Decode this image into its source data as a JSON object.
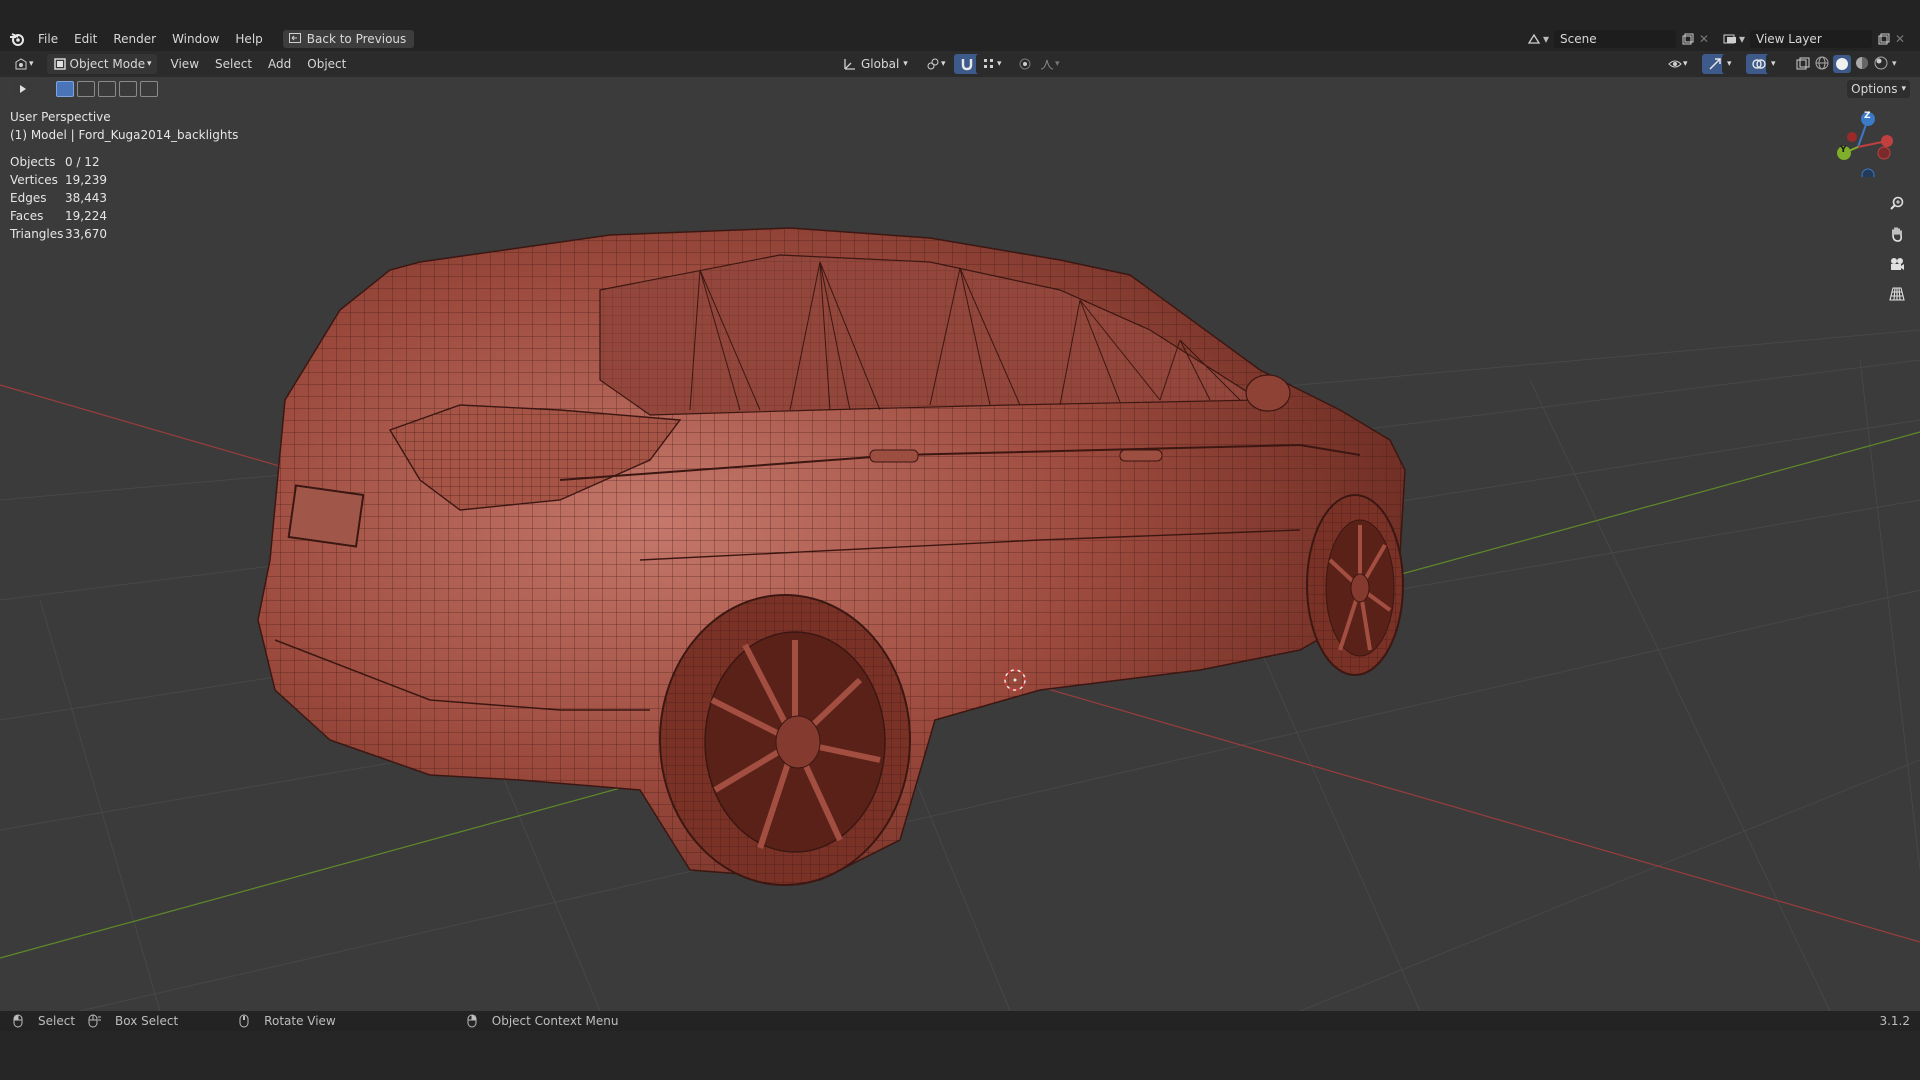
{
  "menu": {
    "items": [
      "File",
      "Edit",
      "Render",
      "Window",
      "Help"
    ],
    "back_button": "Back to Previous"
  },
  "scene": {
    "label": "Scene",
    "view_layer": "View Layer"
  },
  "header": {
    "mode": "Object Mode",
    "menus": [
      "View",
      "Select",
      "Add",
      "Object"
    ],
    "transform_orientation": "Global",
    "options": "Options"
  },
  "viewport": {
    "perspective": "User Perspective",
    "object_info": "(1) Model | Ford_Kuga2014_backlights",
    "stats": [
      {
        "label": "Objects",
        "value": "0 / 12"
      },
      {
        "label": "Vertices",
        "value": "19,239"
      },
      {
        "label": "Edges",
        "value": "38,443"
      },
      {
        "label": "Faces",
        "value": "19,224"
      },
      {
        "label": "Triangles",
        "value": "33,670"
      }
    ],
    "gizmo": {
      "z": "Z",
      "y": "Y"
    },
    "mesh_color": "#8a3b2e",
    "grid_color": "#444444",
    "x_axis_color": "#9a3c3c",
    "y_axis_color": "#5f8a2a"
  },
  "status": {
    "select": "Select",
    "box_select": "Box Select",
    "rotate_view": "Rotate View",
    "context_menu": "Object Context Menu",
    "version": "3.1.2"
  }
}
